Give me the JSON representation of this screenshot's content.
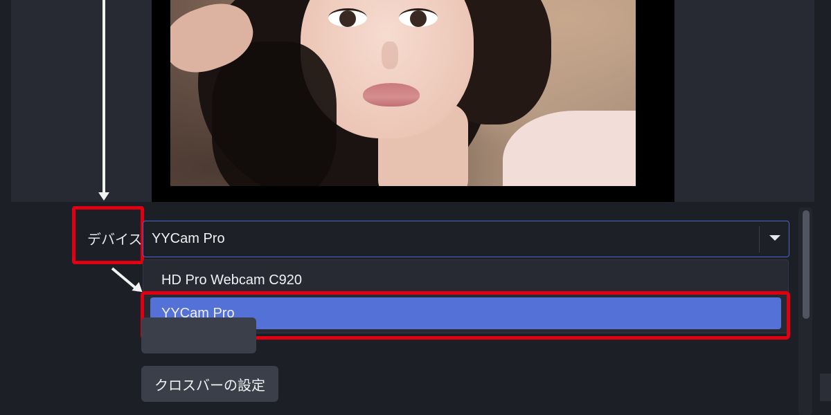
{
  "annotations": {
    "device_label": "デバイス"
  },
  "device_select": {
    "selected": "YYCam Pro",
    "options": [
      "HD Pro Webcam C920",
      "YYCam Pro"
    ]
  },
  "buttons": {
    "hidden_settings": "",
    "crossbar_settings": "クロスバーの設定"
  },
  "colors": {
    "highlight_red": "#e00012",
    "selection_blue": "#5471d8",
    "select_border": "#4a68c8",
    "background": "#1d1f26",
    "panel": "#272a33",
    "button": "#3b3f49"
  },
  "icons": {
    "dropdown_arrow": "caret-down-icon",
    "annotation_arrow": "arrow-down-icon",
    "annotation_diagonal_arrow": "arrow-down-right-icon"
  }
}
